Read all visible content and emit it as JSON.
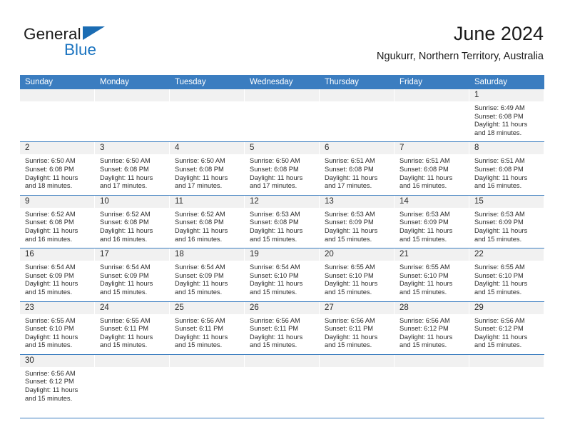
{
  "brand": {
    "name_top": "General",
    "name_bottom": "Blue",
    "flag_icon": "blue-triangle-flag-icon",
    "accent_color": "#1b74c0"
  },
  "header": {
    "title": "June 2024",
    "subtitle": "Ngukurr, Northern Territory, Australia"
  },
  "calendar": {
    "header_bg_color": "#3b7dc0",
    "day_band_color": "#f1f1f1",
    "row_divider_color": "#3b7dc0",
    "weekdays": [
      "Sunday",
      "Monday",
      "Tuesday",
      "Wednesday",
      "Thursday",
      "Friday",
      "Saturday"
    ],
    "weeks": [
      [
        {
          "empty": true
        },
        {
          "empty": true
        },
        {
          "empty": true
        },
        {
          "empty": true
        },
        {
          "empty": true
        },
        {
          "empty": true
        },
        {
          "day": "1",
          "sunrise": "Sunrise: 6:49 AM",
          "sunset": "Sunset: 6:08 PM",
          "daylight1": "Daylight: 11 hours",
          "daylight2": "and 18 minutes."
        }
      ],
      [
        {
          "day": "2",
          "sunrise": "Sunrise: 6:50 AM",
          "sunset": "Sunset: 6:08 PM",
          "daylight1": "Daylight: 11 hours",
          "daylight2": "and 18 minutes."
        },
        {
          "day": "3",
          "sunrise": "Sunrise: 6:50 AM",
          "sunset": "Sunset: 6:08 PM",
          "daylight1": "Daylight: 11 hours",
          "daylight2": "and 17 minutes."
        },
        {
          "day": "4",
          "sunrise": "Sunrise: 6:50 AM",
          "sunset": "Sunset: 6:08 PM",
          "daylight1": "Daylight: 11 hours",
          "daylight2": "and 17 minutes."
        },
        {
          "day": "5",
          "sunrise": "Sunrise: 6:50 AM",
          "sunset": "Sunset: 6:08 PM",
          "daylight1": "Daylight: 11 hours",
          "daylight2": "and 17 minutes."
        },
        {
          "day": "6",
          "sunrise": "Sunrise: 6:51 AM",
          "sunset": "Sunset: 6:08 PM",
          "daylight1": "Daylight: 11 hours",
          "daylight2": "and 17 minutes."
        },
        {
          "day": "7",
          "sunrise": "Sunrise: 6:51 AM",
          "sunset": "Sunset: 6:08 PM",
          "daylight1": "Daylight: 11 hours",
          "daylight2": "and 16 minutes."
        },
        {
          "day": "8",
          "sunrise": "Sunrise: 6:51 AM",
          "sunset": "Sunset: 6:08 PM",
          "daylight1": "Daylight: 11 hours",
          "daylight2": "and 16 minutes."
        }
      ],
      [
        {
          "day": "9",
          "sunrise": "Sunrise: 6:52 AM",
          "sunset": "Sunset: 6:08 PM",
          "daylight1": "Daylight: 11 hours",
          "daylight2": "and 16 minutes."
        },
        {
          "day": "10",
          "sunrise": "Sunrise: 6:52 AM",
          "sunset": "Sunset: 6:08 PM",
          "daylight1": "Daylight: 11 hours",
          "daylight2": "and 16 minutes."
        },
        {
          "day": "11",
          "sunrise": "Sunrise: 6:52 AM",
          "sunset": "Sunset: 6:08 PM",
          "daylight1": "Daylight: 11 hours",
          "daylight2": "and 16 minutes."
        },
        {
          "day": "12",
          "sunrise": "Sunrise: 6:53 AM",
          "sunset": "Sunset: 6:08 PM",
          "daylight1": "Daylight: 11 hours",
          "daylight2": "and 15 minutes."
        },
        {
          "day": "13",
          "sunrise": "Sunrise: 6:53 AM",
          "sunset": "Sunset: 6:09 PM",
          "daylight1": "Daylight: 11 hours",
          "daylight2": "and 15 minutes."
        },
        {
          "day": "14",
          "sunrise": "Sunrise: 6:53 AM",
          "sunset": "Sunset: 6:09 PM",
          "daylight1": "Daylight: 11 hours",
          "daylight2": "and 15 minutes."
        },
        {
          "day": "15",
          "sunrise": "Sunrise: 6:53 AM",
          "sunset": "Sunset: 6:09 PM",
          "daylight1": "Daylight: 11 hours",
          "daylight2": "and 15 minutes."
        }
      ],
      [
        {
          "day": "16",
          "sunrise": "Sunrise: 6:54 AM",
          "sunset": "Sunset: 6:09 PM",
          "daylight1": "Daylight: 11 hours",
          "daylight2": "and 15 minutes."
        },
        {
          "day": "17",
          "sunrise": "Sunrise: 6:54 AM",
          "sunset": "Sunset: 6:09 PM",
          "daylight1": "Daylight: 11 hours",
          "daylight2": "and 15 minutes."
        },
        {
          "day": "18",
          "sunrise": "Sunrise: 6:54 AM",
          "sunset": "Sunset: 6:09 PM",
          "daylight1": "Daylight: 11 hours",
          "daylight2": "and 15 minutes."
        },
        {
          "day": "19",
          "sunrise": "Sunrise: 6:54 AM",
          "sunset": "Sunset: 6:10 PM",
          "daylight1": "Daylight: 11 hours",
          "daylight2": "and 15 minutes."
        },
        {
          "day": "20",
          "sunrise": "Sunrise: 6:55 AM",
          "sunset": "Sunset: 6:10 PM",
          "daylight1": "Daylight: 11 hours",
          "daylight2": "and 15 minutes."
        },
        {
          "day": "21",
          "sunrise": "Sunrise: 6:55 AM",
          "sunset": "Sunset: 6:10 PM",
          "daylight1": "Daylight: 11 hours",
          "daylight2": "and 15 minutes."
        },
        {
          "day": "22",
          "sunrise": "Sunrise: 6:55 AM",
          "sunset": "Sunset: 6:10 PM",
          "daylight1": "Daylight: 11 hours",
          "daylight2": "and 15 minutes."
        }
      ],
      [
        {
          "day": "23",
          "sunrise": "Sunrise: 6:55 AM",
          "sunset": "Sunset: 6:10 PM",
          "daylight1": "Daylight: 11 hours",
          "daylight2": "and 15 minutes."
        },
        {
          "day": "24",
          "sunrise": "Sunrise: 6:55 AM",
          "sunset": "Sunset: 6:11 PM",
          "daylight1": "Daylight: 11 hours",
          "daylight2": "and 15 minutes."
        },
        {
          "day": "25",
          "sunrise": "Sunrise: 6:56 AM",
          "sunset": "Sunset: 6:11 PM",
          "daylight1": "Daylight: 11 hours",
          "daylight2": "and 15 minutes."
        },
        {
          "day": "26",
          "sunrise": "Sunrise: 6:56 AM",
          "sunset": "Sunset: 6:11 PM",
          "daylight1": "Daylight: 11 hours",
          "daylight2": "and 15 minutes."
        },
        {
          "day": "27",
          "sunrise": "Sunrise: 6:56 AM",
          "sunset": "Sunset: 6:11 PM",
          "daylight1": "Daylight: 11 hours",
          "daylight2": "and 15 minutes."
        },
        {
          "day": "28",
          "sunrise": "Sunrise: 6:56 AM",
          "sunset": "Sunset: 6:12 PM",
          "daylight1": "Daylight: 11 hours",
          "daylight2": "and 15 minutes."
        },
        {
          "day": "29",
          "sunrise": "Sunrise: 6:56 AM",
          "sunset": "Sunset: 6:12 PM",
          "daylight1": "Daylight: 11 hours",
          "daylight2": "and 15 minutes."
        }
      ],
      [
        {
          "day": "30",
          "sunrise": "Sunrise: 6:56 AM",
          "sunset": "Sunset: 6:12 PM",
          "daylight1": "Daylight: 11 hours",
          "daylight2": "and 15 minutes."
        },
        {
          "empty": true
        },
        {
          "empty": true
        },
        {
          "empty": true
        },
        {
          "empty": true
        },
        {
          "empty": true
        },
        {
          "empty": true
        }
      ]
    ]
  }
}
